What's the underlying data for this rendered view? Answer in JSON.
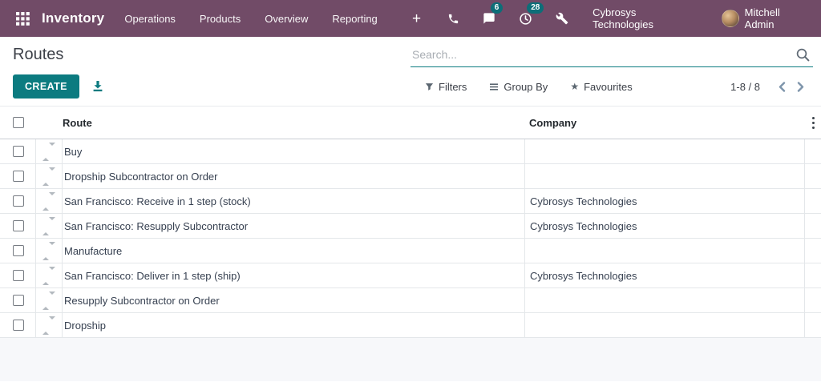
{
  "navbar": {
    "app_name": "Inventory",
    "menu": [
      "Operations",
      "Products",
      "Overview",
      "Reporting"
    ],
    "messages_badge": "6",
    "activities_badge": "28",
    "company": "Cybrosys Technologies",
    "user": "Mitchell Admin"
  },
  "control_panel": {
    "title": "Routes",
    "search_placeholder": "Search...",
    "create_label": "CREATE",
    "filters_label": "Filters",
    "group_by_label": "Group By",
    "favourites_label": "Favourites",
    "pager": "1-8 / 8"
  },
  "table": {
    "columns": [
      "Route",
      "Company"
    ],
    "rows": [
      {
        "route": "Buy",
        "company": ""
      },
      {
        "route": "Dropship Subcontractor on Order",
        "company": ""
      },
      {
        "route": "San Francisco: Receive in 1 step (stock)",
        "company": "Cybrosys Technologies"
      },
      {
        "route": "San Francisco: Resupply Subcontractor",
        "company": "Cybrosys Technologies"
      },
      {
        "route": "Manufacture",
        "company": ""
      },
      {
        "route": "San Francisco: Deliver in 1 step (ship)",
        "company": "Cybrosys Technologies"
      },
      {
        "route": "Resupply Subcontractor on Order",
        "company": ""
      },
      {
        "route": "Dropship",
        "company": ""
      }
    ]
  },
  "icons": {
    "apps": "grid-3x3",
    "plus": "+",
    "phone": "receiver",
    "messages": "chat-bubble",
    "activities": "clock",
    "tools": "wrench",
    "search": "magnifier",
    "export": "download-tray",
    "filter": "funnel",
    "group_by": "bars",
    "favourites_glyph": "★",
    "prev": "chevron-left",
    "next": "chevron-right",
    "options": "kebab-dots",
    "drag": "up-down-triangles"
  },
  "colors": {
    "navbar-bg": "#714B67",
    "accent": "#0c7b80",
    "badge-bg": "#0d6e78",
    "text-dark": "#374151",
    "pager-chevron": "#7e95ab",
    "footer-bg": "#f7f8fa"
  }
}
